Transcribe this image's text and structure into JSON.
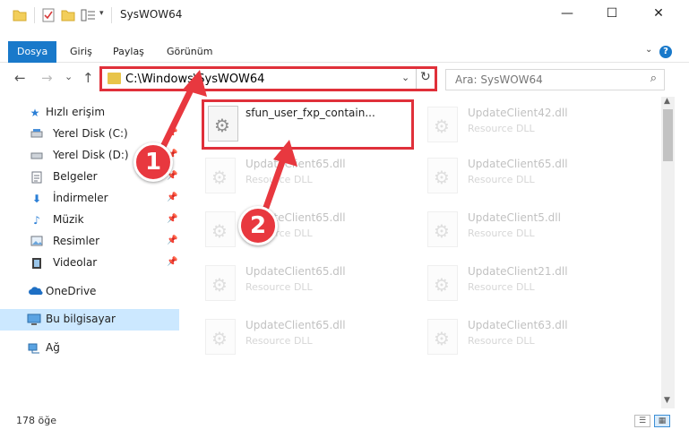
{
  "window": {
    "title": "SysWOW64",
    "minimize": "—",
    "maximize": "☐",
    "close": "✕"
  },
  "ribbon": {
    "tabs": [
      "Dosya",
      "Giriş",
      "Paylaş",
      "Görünüm"
    ],
    "active_tab": "Dosya",
    "help": "?"
  },
  "nav": {
    "back": "←",
    "forward": "→",
    "recent": "⌄",
    "up": "↑",
    "address": "C:\\Windows\\SysWOW64",
    "search_placeholder": "Ara: SysWOW64"
  },
  "sidebar": {
    "items": [
      {
        "label": "Hızlı erişim",
        "icon": "star-icon",
        "pinned": false
      },
      {
        "label": "Yerel Disk (C:)",
        "icon": "drive-icon",
        "pinned": true
      },
      {
        "label": "Yerel Disk (D:)",
        "icon": "drive-icon",
        "pinned": true
      },
      {
        "label": "Belgeler",
        "icon": "document-icon",
        "pinned": true
      },
      {
        "label": "İndirmeler",
        "icon": "download-icon",
        "pinned": true
      },
      {
        "label": "Müzik",
        "icon": "music-icon",
        "pinned": true
      },
      {
        "label": "Resimler",
        "icon": "picture-icon",
        "pinned": true
      },
      {
        "label": "Videolar",
        "icon": "video-icon",
        "pinned": true
      },
      {
        "label": "OneDrive",
        "icon": "cloud-icon",
        "pinned": false
      },
      {
        "label": "Bu bilgisayar",
        "icon": "computer-icon",
        "pinned": false,
        "selected": true
      },
      {
        "label": "Ağ",
        "icon": "network-icon",
        "pinned": false
      }
    ]
  },
  "files": {
    "type_label": "Resource DLL",
    "left_column": [
      {
        "name": "sfun_user_fxp_contain...",
        "type": ""
      },
      {
        "name": "UpdateClient65.dll",
        "type": "Resource DLL"
      },
      {
        "name": "UpdateClient65.dll",
        "type": "Resource DLL"
      },
      {
        "name": "UpdateClient65.dll",
        "type": "Resource DLL"
      },
      {
        "name": "UpdateClient65.dll",
        "type": "Resource DLL"
      }
    ],
    "right_column": [
      {
        "name": "UpdateClient42.dll",
        "type": "Resource DLL"
      },
      {
        "name": "UpdateClient65.dll",
        "type": "Resource DLL"
      },
      {
        "name": "UpdateClient5.dll",
        "type": "Resource DLL"
      },
      {
        "name": "UpdateClient21.dll",
        "type": "Resource DLL"
      },
      {
        "name": "UpdateClient63.dll",
        "type": "Resource DLL"
      }
    ]
  },
  "status": {
    "item_count": "178 öğe"
  },
  "annotations": {
    "step1": "1",
    "step2": "2",
    "color": "#e8383f"
  }
}
